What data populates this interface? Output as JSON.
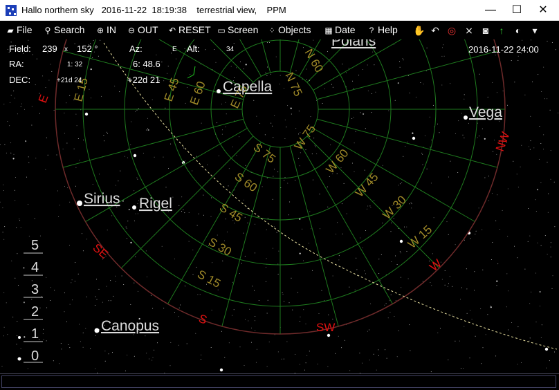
{
  "window": {
    "title": "Hallo northern sky   2016-11-22  18:19:38    terrestrial view,    PPM",
    "controls": {
      "minimize": "—",
      "maximize": "☐",
      "close": "✕"
    }
  },
  "menu": [
    {
      "label": "File",
      "icon": "folder-icon",
      "glyph": "▰"
    },
    {
      "label": "Search",
      "icon": "binoculars-icon",
      "glyph": "⚲"
    },
    {
      "label": "IN",
      "icon": "zoom-in-icon",
      "glyph": "⊕"
    },
    {
      "label": "OUT",
      "icon": "zoom-out-icon",
      "glyph": "⊖"
    },
    {
      "label": "RESET",
      "icon": "reset-arrow-icon",
      "glyph": "↶"
    },
    {
      "label": "Screen",
      "icon": "monitor-icon",
      "glyph": "▭"
    },
    {
      "label": "Objects",
      "icon": "stars-icon",
      "glyph": "⁘"
    },
    {
      "label": "Date",
      "icon": "calendar-icon",
      "glyph": "▦"
    },
    {
      "label": "Help",
      "icon": "help-icon",
      "glyph": "?"
    }
  ],
  "toolbar_icons": [
    {
      "name": "hand-icon",
      "glyph": "✋"
    },
    {
      "name": "undo-icon",
      "glyph": "↶"
    },
    {
      "name": "target-icon",
      "glyph": "◎"
    },
    {
      "name": "grid-icon",
      "glyph": "⨯"
    },
    {
      "name": "camera-icon",
      "glyph": "◙"
    },
    {
      "name": "arrow-up-icon",
      "glyph": "↑"
    },
    {
      "name": "dial-icon",
      "glyph": "◐"
    },
    {
      "name": "dropdown-icon",
      "glyph": "▾"
    }
  ],
  "info": {
    "field_label": "Field:",
    "field_w": "239",
    "x_sep": "x",
    "field_h": "152 °",
    "az_label": "Az:",
    "az_dir": "E",
    "alt_label": "Alt:",
    "alt_value": "34",
    "ra_label": "RA:",
    "ra_small": "1: 32",
    "ra_value": "6: 48.6",
    "dec_label": "DEC:",
    "dec_small": "+21d 24",
    "dec_value": "+22d 21",
    "datetime": "2016-11-22  24:00"
  },
  "stars": [
    {
      "label": "Polaris"
    },
    {
      "label": "Capella"
    },
    {
      "label": "Vega"
    },
    {
      "label": "Sirius"
    },
    {
      "label": "Rigel"
    },
    {
      "label": "Canopus"
    }
  ],
  "compass": [
    "E",
    "NW",
    "SE",
    "W",
    "S",
    "SW"
  ],
  "grid_labels": [
    "N 60",
    "N 75",
    "E 75",
    "E 60",
    "E 45",
    "E 15",
    "S 75",
    "S 60",
    "S 45",
    "S 30",
    "S 15",
    "W 75",
    "W 60",
    "W 45",
    "W 30",
    "W 15"
  ],
  "magnitude_scale": [
    "5",
    "4",
    "3",
    "2",
    "1",
    "0"
  ],
  "colors": {
    "grid": "#1e7a1e",
    "label": "#a08a28",
    "compass": "#e01010",
    "horizon": "#6e2a2a",
    "ecliptic": "#e8e0a0"
  }
}
